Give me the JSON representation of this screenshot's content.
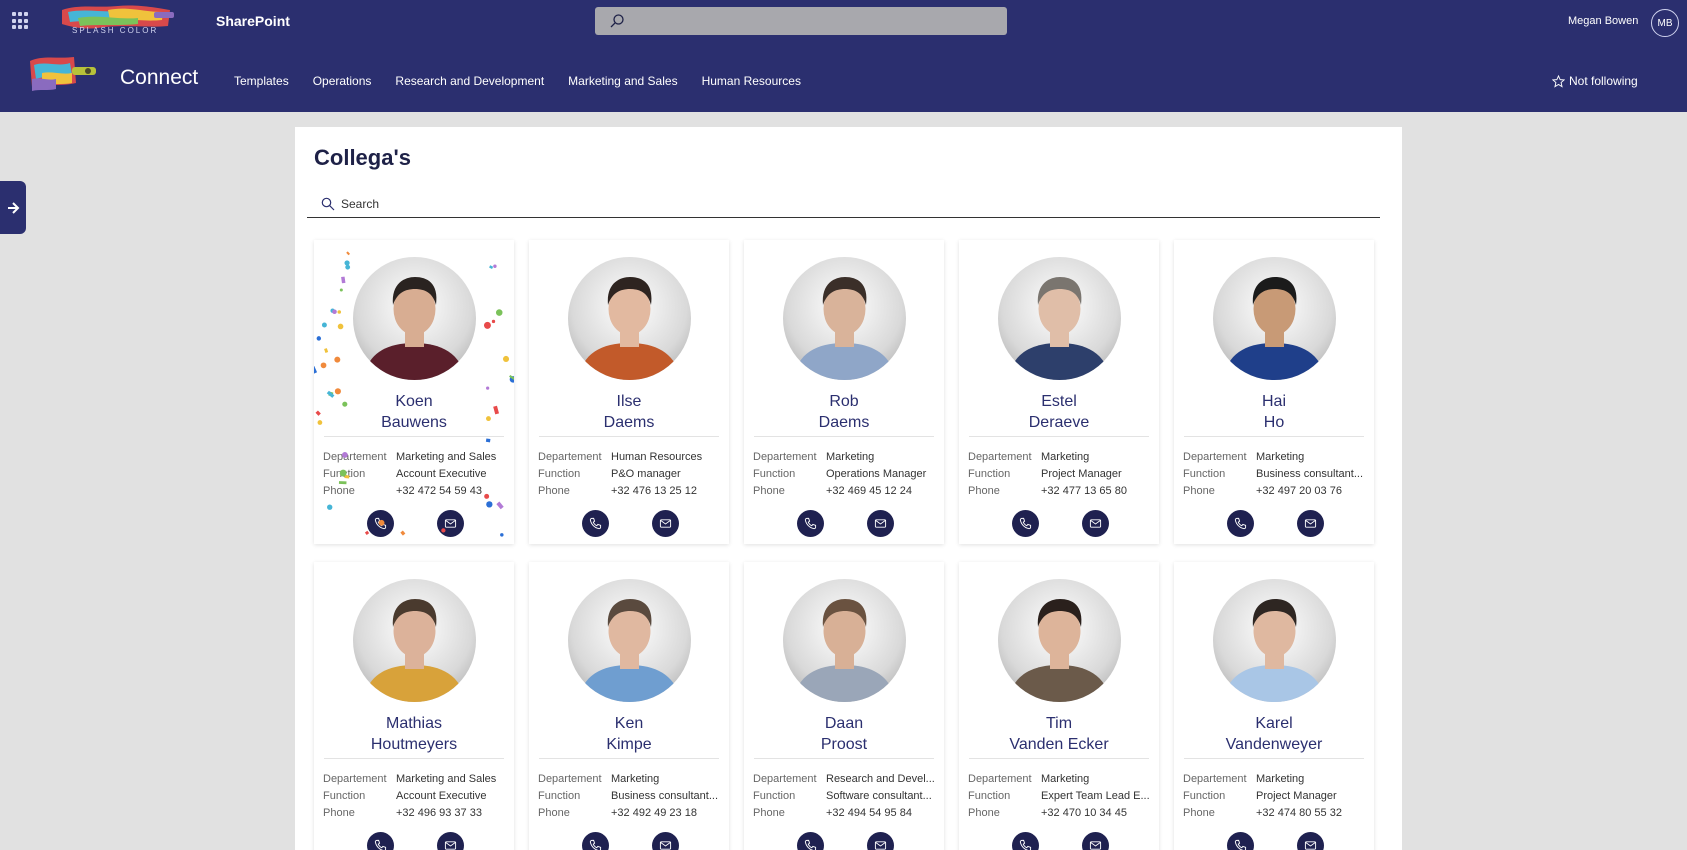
{
  "suite": {
    "logo_text": "SPLASH COLOR",
    "app_name": "SharePoint",
    "user_name": "Megan Bowen",
    "user_initials": "MB"
  },
  "site": {
    "title": "Connect",
    "nav": [
      "Templates",
      "Operations",
      "Research and Development",
      "Marketing and Sales",
      "Human Resources"
    ],
    "follow_label": "Not following"
  },
  "page": {
    "title": "Collega's",
    "search_placeholder": "Search"
  },
  "labels": {
    "department": "Departement",
    "function": "Function",
    "phone": "Phone"
  },
  "people": [
    {
      "first": "Koen",
      "last": "Bauwens",
      "department": "Marketing and Sales",
      "function": "Account Executive",
      "phone": "+32 472 54 59 43",
      "shirt": "#5a1f2b",
      "hair": "#2a2320",
      "skin": "#d8ad92",
      "confetti": true
    },
    {
      "first": "Ilse",
      "last": "Daems",
      "department": "Human Resources",
      "function": "P&O manager",
      "phone": "+32 476 13 25 12",
      "shirt": "#c25a2a",
      "hair": "#2e2420",
      "skin": "#e2b9a0",
      "confetti": false
    },
    {
      "first": "Rob",
      "last": "Daems",
      "department": "Marketing",
      "function": "Operations Manager",
      "phone": "+32 469 45 12 24",
      "shirt": "#8fa6c8",
      "hair": "#3b2f29",
      "skin": "#d9b39a",
      "confetti": false
    },
    {
      "first": "Estel",
      "last": "Deraeve",
      "department": "Marketing",
      "function": "Project Manager",
      "phone": "+32 477 13 65 80",
      "shirt": "#2d3f6b",
      "hair": "#7a756f",
      "skin": "#e0bea8",
      "confetti": false
    },
    {
      "first": "Hai",
      "last": "Ho",
      "department": "Marketing",
      "function": "Business consultant...",
      "phone": "+32 497 20 03 76",
      "shirt": "#1f3f8a",
      "hair": "#1b1b1b",
      "skin": "#c89a76",
      "confetti": false
    },
    {
      "first": "Mathias",
      "last": "Houtmeyers",
      "department": "Marketing and Sales",
      "function": "Account Executive",
      "phone": "+32 496 93 37 33",
      "shirt": "#d8a23a",
      "hair": "#4a3a2e",
      "skin": "#dcb29a",
      "confetti": false
    },
    {
      "first": "Ken",
      "last": "Kimpe",
      "department": "Marketing",
      "function": "Business consultant...",
      "phone": "+32 492 49 23 18",
      "shirt": "#6f9ed0",
      "hair": "#5a4a3e",
      "skin": "#e0b8a0",
      "confetti": false
    },
    {
      "first": "Daan",
      "last": "Proost",
      "department": "Research and Devel...",
      "function": "Software consultant...",
      "phone": "+32 494 54 95 84",
      "shirt": "#9aa6b8",
      "hair": "#6a5240",
      "skin": "#d8b096",
      "confetti": false
    },
    {
      "first": "Tim",
      "last": "Vanden Ecker",
      "department": "Marketing",
      "function": "Expert Team Lead E...",
      "phone": "+32 470 10 34 45",
      "shirt": "#6b5a4a",
      "hair": "#2a201c",
      "skin": "#ddb49a",
      "confetti": false
    },
    {
      "first": "Karel",
      "last": "Vandenweyer",
      "department": "Marketing",
      "function": "Project Manager",
      "phone": "+32 474 80 55 32",
      "shirt": "#a9c6e6",
      "hair": "#2e2622",
      "skin": "#dfb8a0",
      "confetti": false
    }
  ],
  "colors": {
    "brand": "#2b2f6f",
    "name_text": "#2b2f6f",
    "action_button": "#1f2150"
  },
  "icons": {
    "call": "phone-icon",
    "mail": "mail-icon"
  }
}
